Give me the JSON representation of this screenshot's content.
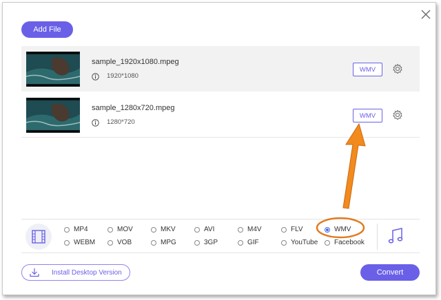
{
  "toolbar": {
    "add_file_label": "Add File"
  },
  "files": [
    {
      "name": "sample_1920x1080.mpeg",
      "resolution": "1920*1080",
      "format": "WMV"
    },
    {
      "name": "sample_1280x720.mpeg",
      "resolution": "1280*720",
      "format": "WMV"
    }
  ],
  "formats": {
    "row1": [
      "MP4",
      "MOV",
      "MKV",
      "AVI",
      "M4V",
      "FLV",
      "WMV"
    ],
    "row2": [
      "WEBM",
      "VOB",
      "MPG",
      "3GP",
      "GIF",
      "YouTube",
      "Facebook"
    ],
    "selected": "WMV"
  },
  "footer": {
    "install_label": "Install Desktop Version",
    "convert_label": "Convert"
  },
  "colors": {
    "accent": "#6a60e8",
    "annotation": "#f28a1e"
  },
  "icons": [
    "close-icon",
    "info-icon",
    "gear-icon",
    "film-icon",
    "music-note-icon",
    "download-icon"
  ]
}
